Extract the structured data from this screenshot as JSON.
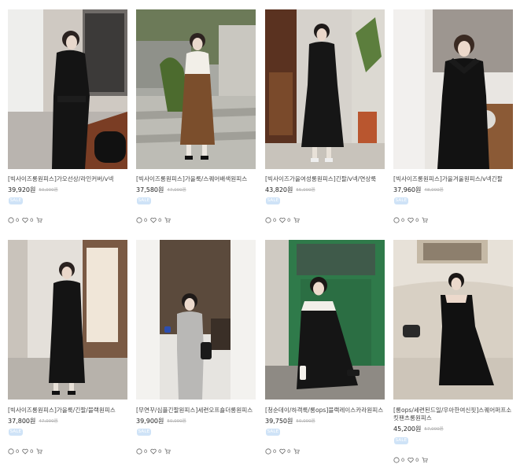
{
  "products": [
    {
      "title": "[빅사이즈롱원피스]가오선상/라인커버/v넥",
      "price": "39,920원",
      "orig": "50,000원",
      "badge": "SALE",
      "comments": "0",
      "likes": "0"
    },
    {
      "title": "[빅사이즈롱원피스]가을룩/스퀘어배색원피스",
      "price": "37,580원",
      "orig": "47,000원",
      "badge": "SALE",
      "comments": "0",
      "likes": "0"
    },
    {
      "title": "[빅사이즈가을여성롱원피스]긴팔/v넥/연상룩",
      "price": "43,820원",
      "orig": "55,000원",
      "badge": "SALE",
      "comments": "0",
      "likes": "0"
    },
    {
      "title": "[빅사이즈롱원피스]가을겨울원피스/v넥긴팔",
      "price": "37,960원",
      "orig": "48,000원",
      "badge": "SALE",
      "comments": "0",
      "likes": "0"
    },
    {
      "title": "[빅사이즈롱원피스]가을룩/긴팔/블랙원피스",
      "price": "37,800원",
      "orig": "47,000원",
      "badge": "SALE",
      "comments": "0",
      "likes": "0"
    },
    {
      "title": "[무연꾸/심플긴팔원피스]세련오프숄더롱원피스",
      "price": "39,900원",
      "orig": "50,000원",
      "badge": "SALE",
      "comments": "0",
      "likes": "0"
    },
    {
      "title": "[청순데이/하객룩/롱ops]블랙레이스카라원피스",
      "price": "39,750원",
      "orig": "50,000원",
      "badge": "SALE",
      "comments": "0",
      "likes": "0"
    },
    {
      "title": "[롱ops/세련된드일/우아한여신핏]스퀘어퍼프소킷팬츠롱원피스",
      "price": "45,200원",
      "orig": "57,000원",
      "badge": "SALE",
      "comments": "0",
      "likes": "0"
    }
  ],
  "icons": {
    "comment": "comment-icon",
    "like": "heart-icon",
    "cart": "cart-icon"
  }
}
